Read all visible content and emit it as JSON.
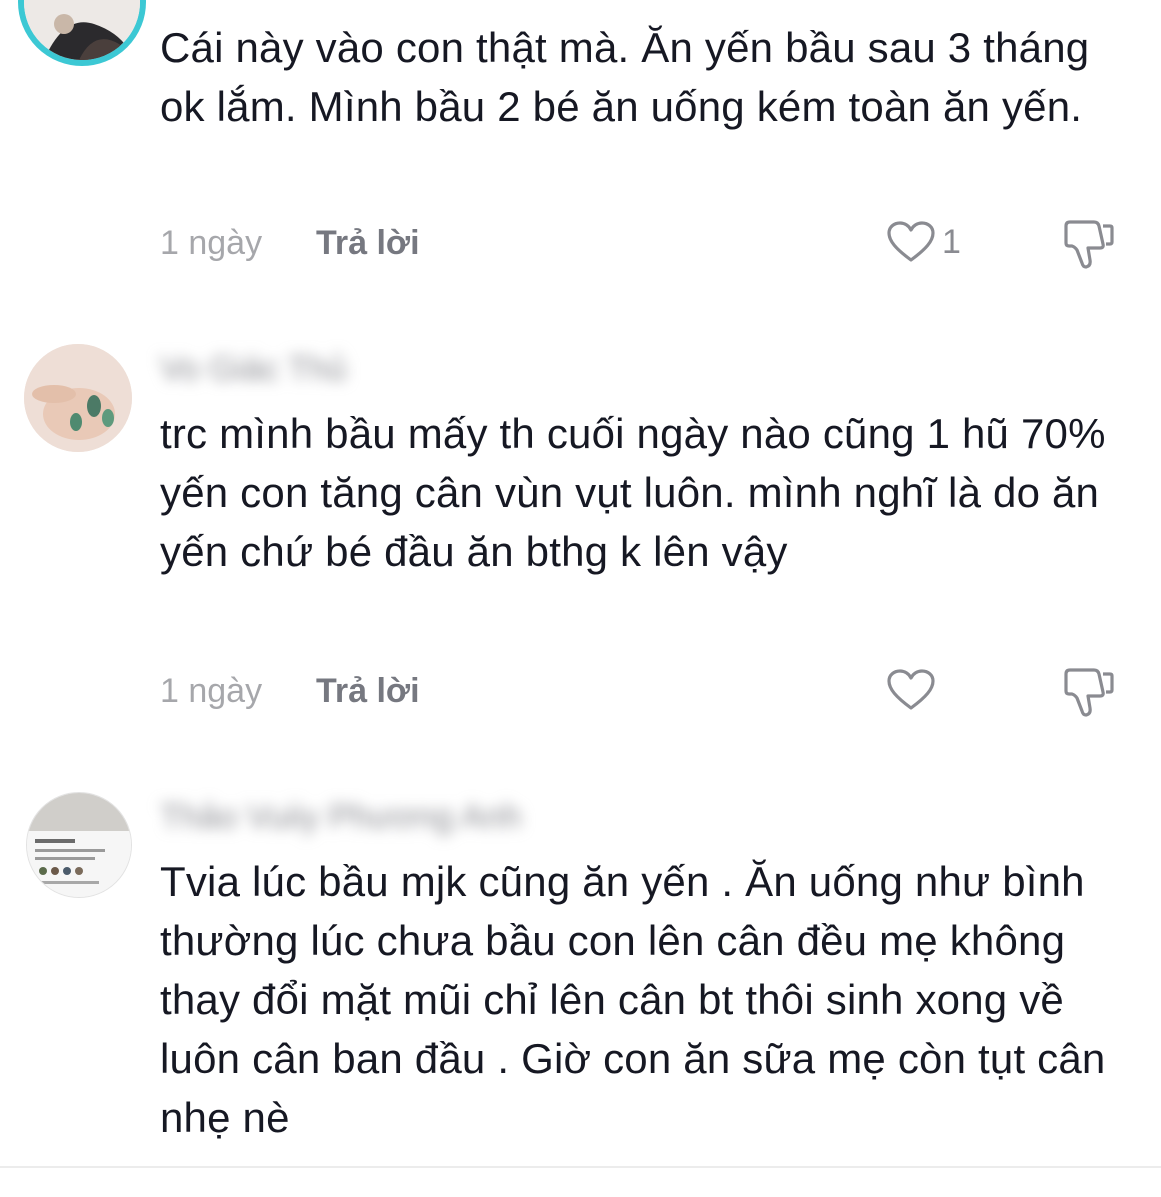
{
  "comments": [
    {
      "text": "Cái này vào con thật mà. Ăn yến bầu sau 3 tháng ok lắm. Mình bầu 2 bé ăn uống kém toàn ăn yến.",
      "time": "1 ngày",
      "reply_label": "Trả lời",
      "like_count": "1"
    },
    {
      "username": "Vo Giác Thủ",
      "text": "trc mình bầu mấy th cuối ngày nào cũng 1 hũ 70% yến con tăng cân vùn vụt luôn. mình nghĩ là do ăn yến chứ bé đầu ăn bthg k lên vậy",
      "time": "1 ngày",
      "reply_label": "Trả lời",
      "like_count": ""
    },
    {
      "username": "Thảo Vuiiy Phương Anh",
      "text": "Tvia lúc bầu mjk cũng ăn yến . Ăn uống như bình thường lúc chưa bầu con lên cân đều mẹ không thay đổi mặt mũi chỉ lên cân bt thôi sinh xong về luôn cân ban đầu . Giờ con ăn sữa mẹ còn tụt cân nhẹ nè"
    }
  ],
  "colors": {
    "text": "#161823",
    "muted": "#a6a7ab",
    "reply": "#767880",
    "avatar_ring": "#3cc8d4"
  },
  "icons": [
    "heart-outline-icon",
    "thumbs-down-icon"
  ]
}
